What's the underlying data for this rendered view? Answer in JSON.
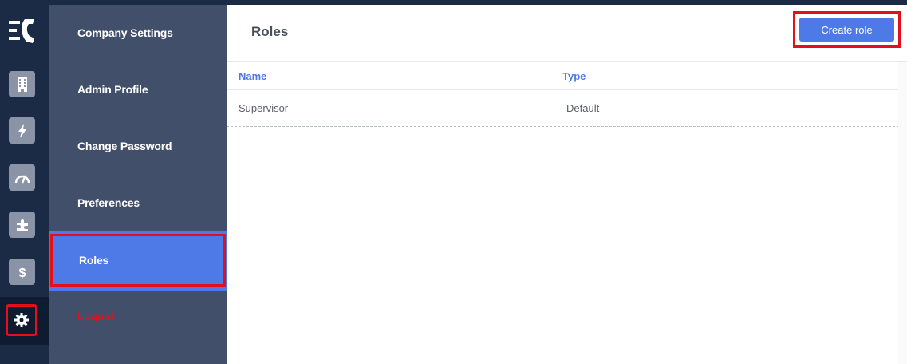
{
  "rail": {
    "items": [
      {
        "name": "building-icon"
      },
      {
        "name": "lightning-icon"
      },
      {
        "name": "gauge-icon"
      },
      {
        "name": "puzzle-icon"
      },
      {
        "name": "dollar-icon"
      },
      {
        "name": "gear-icon",
        "active": true
      }
    ]
  },
  "sidebar": {
    "items": [
      {
        "label": "Company Settings"
      },
      {
        "label": "Admin Profile"
      },
      {
        "label": "Change Password"
      },
      {
        "label": "Preferences"
      },
      {
        "label": "Roles",
        "active": true
      },
      {
        "label": "Logout"
      }
    ]
  },
  "main": {
    "title": "Roles",
    "create_button": "Create role",
    "table": {
      "columns": [
        "Name",
        "Type"
      ],
      "rows": [
        {
          "name": "Supervisor",
          "type": "Default"
        }
      ]
    }
  },
  "colors": {
    "accent": "#4e7ae8",
    "sidebar_bg": "#424f6b",
    "rail_bg": "#1b2a45",
    "highlight": "#e3101b",
    "logout": "#e3101b"
  }
}
